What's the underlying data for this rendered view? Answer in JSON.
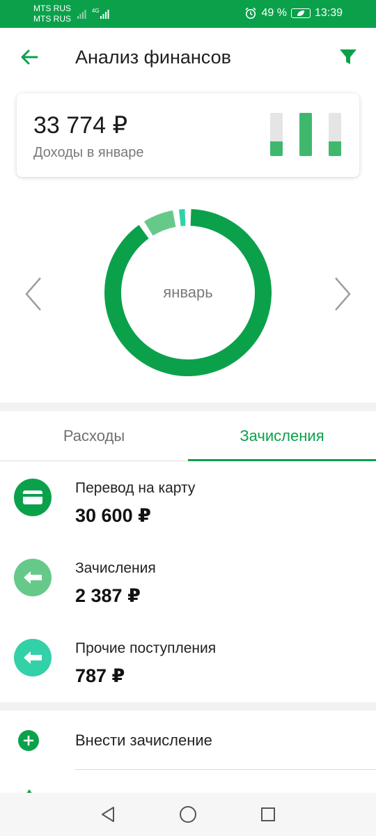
{
  "status_bar": {
    "carrier_1": "MTS RUS",
    "carrier_2": "MTS RUS",
    "network": "4G",
    "battery": "49 %",
    "time": "13:39",
    "icons": [
      "signal-icon",
      "alarm-icon",
      "battery-icon"
    ]
  },
  "app_bar": {
    "title": "Анализ финансов",
    "back_icon": "arrow-left-icon",
    "filter_icon": "filter-icon"
  },
  "summary": {
    "amount": "33 774 ₽",
    "label": "Доходы в январе",
    "bar_levels": [
      0.34,
      1.0,
      0.34
    ]
  },
  "chart": {
    "center_label": "январь",
    "colors": [
      "#0ba14b",
      "#66c98a",
      "#33d1a8"
    ]
  },
  "tabs": {
    "expenses": "Расходы",
    "income": "Зачисления",
    "active": "income"
  },
  "items": [
    {
      "title": "Перевод на карту",
      "amount": "30 600 ₽",
      "value": 30600,
      "color": "#0ba14b",
      "icon": "card-icon"
    },
    {
      "title": "Зачисления",
      "amount": "2 387 ₽",
      "value": 2387,
      "color": "#66c98a",
      "icon": "arrow-in-icon"
    },
    {
      "title": "Прочие поступления",
      "amount": "787 ₽",
      "value": 787,
      "color": "#33d1a8",
      "icon": "arrow-in-icon"
    }
  ],
  "action": {
    "label": "Внести зачисление",
    "icon": "plus-icon"
  },
  "colors": {
    "brand": "#0ba14b",
    "text_secondary": "#7a7a7a",
    "nav_icons": "#555555"
  }
}
